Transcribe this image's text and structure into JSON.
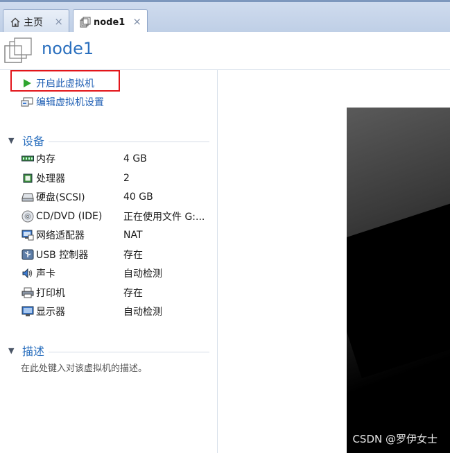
{
  "tabs": [
    {
      "label": "主页",
      "close": "×"
    },
    {
      "label": "node1",
      "close": "×"
    }
  ],
  "vm": {
    "title": "node1"
  },
  "actions": {
    "power_on": "开启此虚拟机",
    "edit_settings": "编辑虚拟机设置"
  },
  "devices": {
    "title": "设备",
    "items": [
      {
        "name": "内存",
        "value": "4 GB",
        "icon": "memory-icon"
      },
      {
        "name": "处理器",
        "value": "2",
        "icon": "processor-icon"
      },
      {
        "name": "硬盘(SCSI)",
        "value": "40 GB",
        "icon": "hard-disk-icon"
      },
      {
        "name": "CD/DVD (IDE)",
        "value": "正在使用文件 G:...",
        "icon": "cd-dvd-icon"
      },
      {
        "name": "网络适配器",
        "value": "NAT",
        "icon": "network-adapter-icon"
      },
      {
        "name": "USB 控制器",
        "value": "存在",
        "icon": "usb-icon"
      },
      {
        "name": "声卡",
        "value": "自动检测",
        "icon": "sound-card-icon"
      },
      {
        "name": "打印机",
        "value": "存在",
        "icon": "printer-icon"
      },
      {
        "name": "显示器",
        "value": "自动检测",
        "icon": "display-icon"
      }
    ]
  },
  "description": {
    "title": "描述",
    "placeholder": "在此处键入对该虚拟机的描述。"
  },
  "watermark": "CSDN @罗伊女士",
  "colors": {
    "accent": "#2a6fbe",
    "highlight": "#e3151a",
    "play": "#2fa52f"
  }
}
